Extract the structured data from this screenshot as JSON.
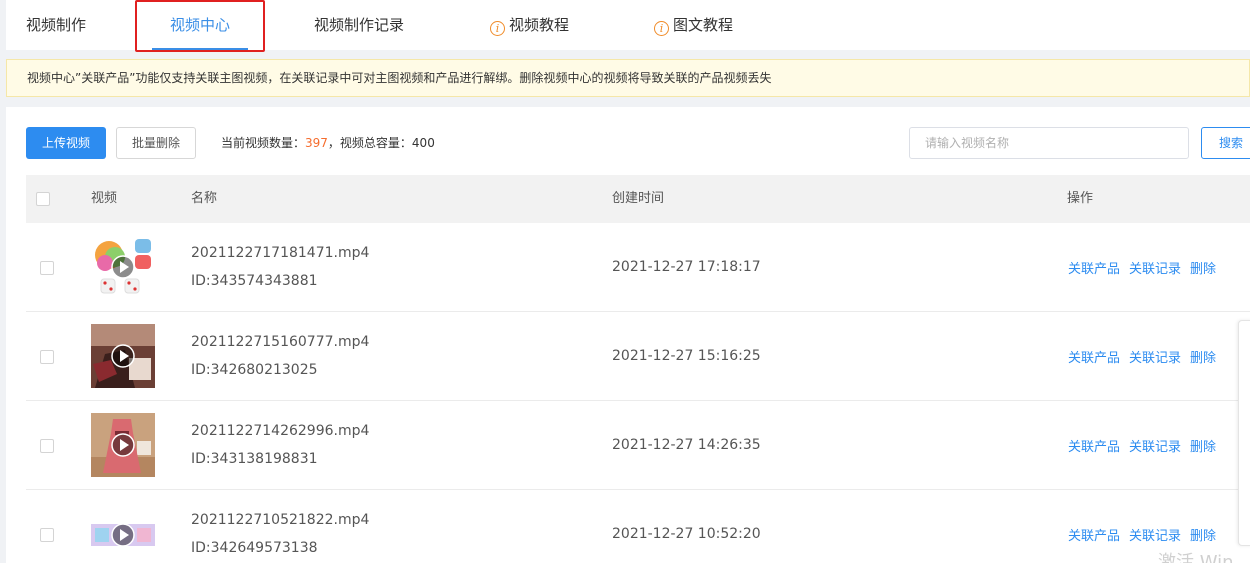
{
  "tabs": [
    {
      "label": "视频制作"
    },
    {
      "label": "视频中心"
    },
    {
      "label": "视频制作记录"
    },
    {
      "label": "视频教程",
      "icon": "info-icon"
    },
    {
      "label": "图文教程",
      "icon": "info-icon"
    }
  ],
  "notice": "视频中心”关联产品”功能仅支持关联主图视频，在关联记录中可对主图视频和产品进行解绑。删除视频中心的视频将导致关联的产品视频丢失",
  "toolbar": {
    "upload_label": "上传视频",
    "batch_delete_label": "批量删除",
    "count_prefix": "当前视频数量：",
    "count_value": "397",
    "capacity_text": "，视频总容量：400",
    "search_placeholder": "请输入视频名称",
    "search_label": "搜索"
  },
  "table": {
    "headers": {
      "video": "视频",
      "name": "名称",
      "created": "创建时间",
      "ops": "操作"
    },
    "rows": [
      {
        "filename": "2021122717181471.mp4",
        "id": "ID:343574343881",
        "created": "2021-12-27 17:18:17"
      },
      {
        "filename": "2021122715160777.mp4",
        "id": "ID:342680213025",
        "created": "2021-12-27 15:16:25"
      },
      {
        "filename": "2021122714262996.mp4",
        "id": "ID:343138198831",
        "created": "2021-12-27 14:26:35"
      },
      {
        "filename": "2021122710521822.mp4",
        "id": "ID:342649573138",
        "created": "2021-12-27 10:52:20"
      }
    ],
    "actions": {
      "link_product": "关联产品",
      "link_record": "关联记录",
      "delete": "删除"
    }
  },
  "watermark": "激活 Win",
  "colors": {
    "accent": "#2d8cf0",
    "highlight": "#e02020",
    "count": "#f56c2d",
    "notice_bg": "#fffbe6"
  }
}
